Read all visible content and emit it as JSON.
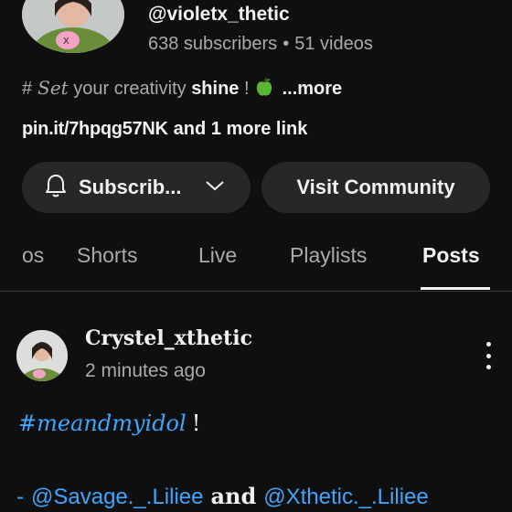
{
  "channel": {
    "handle": "@violetx_thetic",
    "subscribers": "638 subscribers",
    "separator": "•",
    "videos": "51 videos",
    "description": {
      "hash": "#",
      "script_word": "Set",
      "text": " your creativity ",
      "strong": "shine",
      "tail": " !",
      "emoji": "green-apple-icon",
      "more": "...more"
    },
    "link": "pin.it/7hpqg57NK",
    "more_links": "and 1 more link"
  },
  "actions": {
    "subscribe_label": "Subscrib...",
    "community_label": "Visit Community"
  },
  "tabs": [
    {
      "label": "os",
      "active": false
    },
    {
      "label": "Shorts",
      "active": false
    },
    {
      "label": "Live",
      "active": false
    },
    {
      "label": "Playlists",
      "active": false
    },
    {
      "label": "Posts",
      "active": true
    }
  ],
  "post": {
    "author": "Crystel_xthetic",
    "time": "2 minutes ago",
    "hashtag": "#meandmyidol",
    "exclaim": "!",
    "dash": "-",
    "mention1": "@Savage._.Liliee",
    "and_word": "and",
    "mention2": "@Xthetic._.Liliee"
  },
  "colors": {
    "background": "#0f0f0f",
    "button_bg": "#272727",
    "link_blue": "#3ea6ff",
    "muted_text": "#aaaaaa"
  }
}
